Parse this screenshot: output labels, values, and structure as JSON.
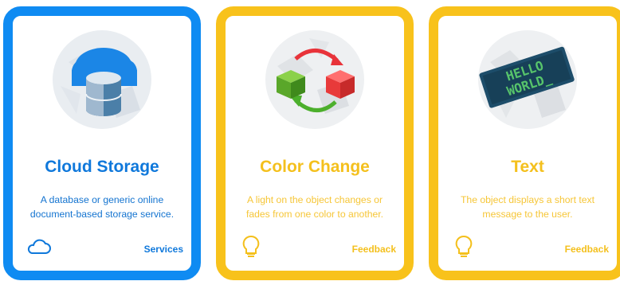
{
  "cards": [
    {
      "title": "Cloud Storage",
      "description": "A database or generic online document-based storage service.",
      "category": "Services",
      "footer_icon": "cloud-icon",
      "illustration": "cloud-database-illustration",
      "accent": "#0f8bf2"
    },
    {
      "title": "Color Change",
      "description": "A light on the object changes or fades from one color to another.",
      "category": "Feedback",
      "footer_icon": "lightbulb-icon",
      "illustration": "color-change-blocks-illustration",
      "accent": "#f8c21b"
    },
    {
      "title": "Text",
      "description": "The object displays a short text message to the user.",
      "category": "Feedback",
      "footer_icon": "lightbulb-icon",
      "illustration": "led-text-display-illustration",
      "display_text_line1": "HELLO",
      "display_text_line2": "WORLD_",
      "accent": "#f8c21b"
    }
  ]
}
